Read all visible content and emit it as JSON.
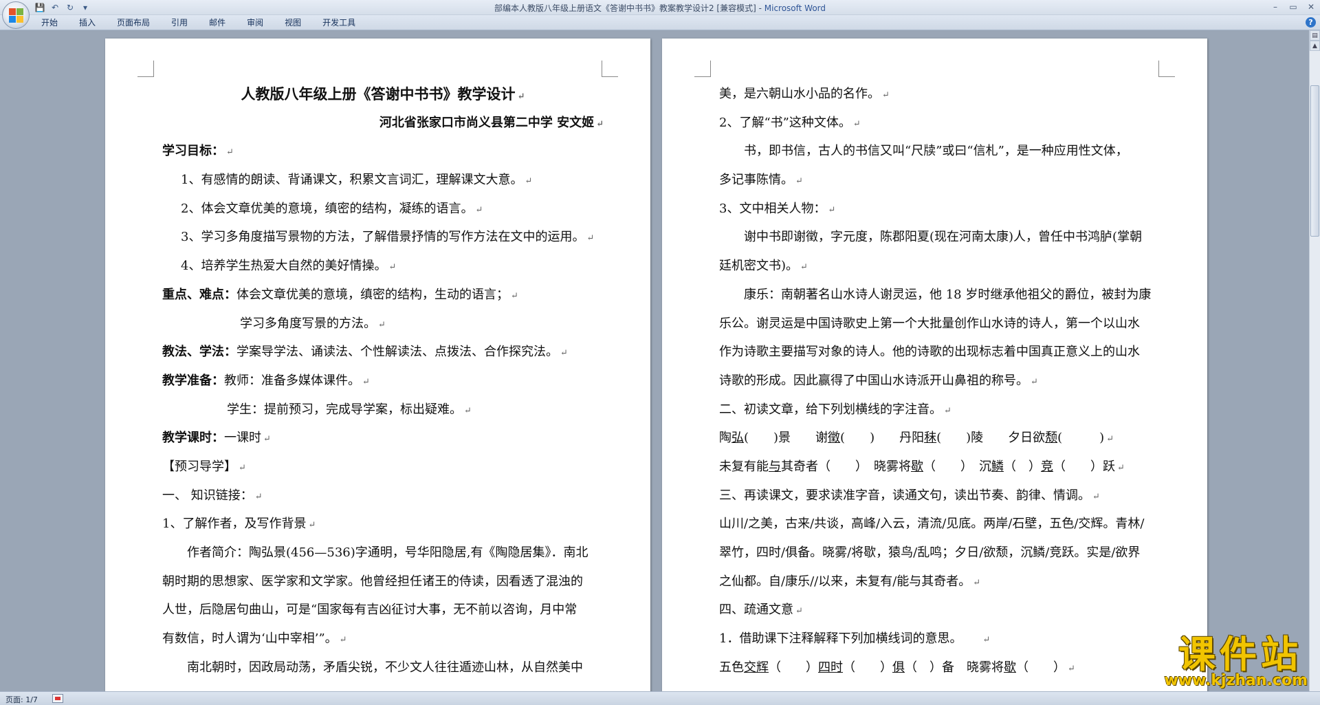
{
  "window": {
    "title": "部编本人教版八年级上册语文《答谢中书书》教案教学设计2 [兼容模式]",
    "app": "Microsoft Word",
    "separator": " - "
  },
  "quick_access": [
    {
      "name": "save-icon",
      "glyph": "💾"
    },
    {
      "name": "undo-icon",
      "glyph": "↶"
    },
    {
      "name": "redo-icon",
      "glyph": "↻"
    },
    {
      "name": "customize-icon",
      "glyph": "▾"
    }
  ],
  "ribbon": {
    "tabs": [
      "开始",
      "插入",
      "页面布局",
      "引用",
      "邮件",
      "审阅",
      "视图",
      "开发工具"
    ]
  },
  "status": {
    "page": "页面: 1/7"
  },
  "watermark": {
    "main": "课件站",
    "url": "www.kjzhan.com"
  },
  "doc": {
    "left": [
      {
        "cls": "title",
        "runs": [
          {
            "t": "人教版八年级上册《答谢中书书》教学设计"
          }
        ],
        "mark": "↵"
      },
      {
        "cls": "right",
        "runs": [
          {
            "t": "河北省张家口市尚义县第二中学   安文姬"
          }
        ],
        "mark": "↵"
      },
      {
        "cls": "",
        "runs": [
          {
            "t": "学习目标：",
            "b": true
          }
        ],
        "mark": "↵"
      },
      {
        "cls": "indent1",
        "runs": [
          {
            "t": "1、有感情的朗读、背诵课文，积累文言词汇，理解课文大意。"
          }
        ],
        "mark": "↵"
      },
      {
        "cls": "indent1",
        "runs": [
          {
            "t": "2、体会文章优美的意境，缜密的结构，凝练的语言。"
          }
        ],
        "mark": "↵"
      },
      {
        "cls": "indent1",
        "runs": [
          {
            "t": "3、学习多角度描写景物的方法，了解借景抒情的写作方法在文中的运用。"
          }
        ],
        "mark": "↵"
      },
      {
        "cls": "indent1",
        "runs": [
          {
            "t": "4、培养学生热爱大自然的美好情操。"
          }
        ],
        "mark": "↵"
      },
      {
        "cls": "",
        "runs": [
          {
            "t": "重点、难点：",
            "b": true
          },
          {
            "t": "体会文章优美的意境，缜密的结构，生动的语言；"
          }
        ],
        "mark": "↵"
      },
      {
        "cls": "indent3",
        "runs": [
          {
            "t": "学习多角度写景的方法。"
          }
        ],
        "mark": "↵"
      },
      {
        "cls": "",
        "runs": [
          {
            "t": "教法、学法：",
            "b": true
          },
          {
            "t": "学案导学法、诵读法、个性解读法、点拨法、合作探究法。"
          }
        ],
        "mark": "↵"
      },
      {
        "cls": "",
        "runs": [
          {
            "t": "教学准备：",
            "b": true
          },
          {
            "t": "教师：准备多媒体课件。"
          }
        ],
        "mark": "↵"
      },
      {
        "cls": "indent4",
        "runs": [
          {
            "t": "学生：提前预习，完成导学案，标出疑难。"
          }
        ],
        "mark": "↵"
      },
      {
        "cls": "",
        "runs": [
          {
            "t": "教学课时：",
            "b": true
          },
          {
            "t": "一课时"
          }
        ],
        "mark": "↵"
      },
      {
        "cls": "",
        "runs": [
          {
            "t": "【预习导学】"
          }
        ],
        "mark": "↵"
      },
      {
        "cls": "",
        "runs": [
          {
            "t": "一、    知识链接："
          }
        ],
        "mark": "↵"
      },
      {
        "cls": "",
        "runs": [
          {
            "t": "1、了解作者，及写作背景"
          }
        ],
        "mark": "↵"
      },
      {
        "cls": "indent2",
        "runs": [
          {
            "t": "作者简介：陶弘景(456—536)字通明，号华阳隐居,有《陶隐居集》．南北"
          }
        ],
        "mark": ""
      },
      {
        "cls": "",
        "runs": [
          {
            "t": "朝时期的思想家、医学家和文学家。他曾经担任诸王的侍读，因看透了混浊的"
          }
        ],
        "mark": ""
      },
      {
        "cls": "",
        "runs": [
          {
            "t": "人世，后隐居句曲山，可是“国家每有吉凶征讨大事，无不前以咨询，月中常"
          }
        ],
        "mark": ""
      },
      {
        "cls": "",
        "runs": [
          {
            "t": "有数信，时人谓为‘山中宰相’”。"
          }
        ],
        "mark": "↵"
      },
      {
        "cls": "indent2",
        "runs": [
          {
            "t": "南北朝时，因政局动荡，矛盾尖锐，不少文人往往遁迹山林，从自然美中"
          }
        ],
        "mark": ""
      }
    ],
    "right": [
      {
        "cls": "",
        "runs": [
          {
            "t": "美，是六朝山水小品的名作。"
          }
        ],
        "mark": "↵"
      },
      {
        "cls": "",
        "runs": [
          {
            "t": "2、了解“书”这种文体。"
          }
        ],
        "mark": "↵"
      },
      {
        "cls": "indent2",
        "runs": [
          {
            "t": "书，即书信，古人的书信又叫“尺牍”或曰“信札”，是一种应用性文体，"
          }
        ],
        "mark": ""
      },
      {
        "cls": "",
        "runs": [
          {
            "t": "多记事陈情。"
          }
        ],
        "mark": "↵"
      },
      {
        "cls": "",
        "runs": [
          {
            "t": "3、文中相关人物："
          }
        ],
        "mark": "↵"
      },
      {
        "cls": "indent2",
        "runs": [
          {
            "t": "谢中书即谢徵，字元度，陈郡阳夏(现在河南太康)人，曾任中书鸿胪(掌朝"
          }
        ],
        "mark": ""
      },
      {
        "cls": "",
        "runs": [
          {
            "t": "廷机密文书)。"
          }
        ],
        "mark": "↵"
      },
      {
        "cls": "indent2",
        "runs": [
          {
            "t": "康乐：南朝著名山水诗人谢灵运，他 18 岁时继承他祖父的爵位，被封为康"
          }
        ],
        "mark": ""
      },
      {
        "cls": "",
        "runs": [
          {
            "t": "乐公。谢灵运是中国诗歌史上第一个大批量创作山水诗的诗人，第一个以山水"
          }
        ],
        "mark": ""
      },
      {
        "cls": "",
        "runs": [
          {
            "t": "作为诗歌主要描写对象的诗人。他的诗歌的出现标志着中国真正意义上的山水"
          }
        ],
        "mark": ""
      },
      {
        "cls": "",
        "runs": [
          {
            "t": "诗歌的形成。因此赢得了中国山水诗派开山鼻祖的称号。"
          }
        ],
        "mark": "↵"
      },
      {
        "cls": "",
        "runs": [
          {
            "t": "二、初读文章，给下列划横线的字注音。"
          }
        ],
        "mark": "↵"
      },
      {
        "cls": "",
        "runs": [
          {
            "t": "陶"
          },
          {
            "t": "弘",
            "u": true
          },
          {
            "t": "(　　)景　　谢"
          },
          {
            "t": "徵",
            "u": true
          },
          {
            "t": "(　　)　　丹阳"
          },
          {
            "t": "秣",
            "u": true
          },
          {
            "t": "(　　)陵　　夕日欲"
          },
          {
            "t": "颓",
            "u": true
          },
          {
            "t": "(　　　)"
          }
        ],
        "mark": "↵"
      },
      {
        "cls": "",
        "runs": [
          {
            "t": "未复有能"
          },
          {
            "t": "与",
            "u": true
          },
          {
            "t": "其奇者（　　）　晓雾将"
          },
          {
            "t": "歇",
            "u": true
          },
          {
            "t": "（　　）　沉"
          },
          {
            "t": "鳞",
            "u": true
          },
          {
            "t": "（　）"
          },
          {
            "t": "竞",
            "u": true
          },
          {
            "t": "（　　）跃"
          }
        ],
        "mark": "↵"
      },
      {
        "cls": "",
        "runs": [
          {
            "t": "三、再读课文，要求读准字音，读通文句，读出节奏、韵律、情调。"
          }
        ],
        "mark": "↵"
      },
      {
        "cls": "",
        "runs": [
          {
            "t": "山川/之美，古来/共谈，高峰/入云，清流/见底。两岸/石壁，五色/交辉。青林/"
          }
        ],
        "mark": ""
      },
      {
        "cls": "",
        "runs": [
          {
            "t": "翠竹，四时/俱备。晓雾/将歇，猿鸟/乱鸣；夕日/欲颓，沉鳞/竞跃。实是/欲界"
          }
        ],
        "mark": ""
      },
      {
        "cls": "",
        "runs": [
          {
            "t": "之仙都。自/康乐//以来，未复有/能与其奇者。"
          }
        ],
        "mark": "↵"
      },
      {
        "cls": "",
        "runs": [
          {
            "t": "四、疏通文意"
          }
        ],
        "mark": "↵"
      },
      {
        "cls": "",
        "runs": [
          {
            "t": "1．借助课下注释解释下列加横线词的意思。　　"
          }
        ],
        "mark": "↵"
      },
      {
        "cls": "",
        "runs": [
          {
            "t": "五色"
          },
          {
            "t": "交辉",
            "u": true
          },
          {
            "t": "（　　）"
          },
          {
            "t": "四时",
            "u": true
          },
          {
            "t": "（　　）"
          },
          {
            "t": "俱",
            "u": true
          },
          {
            "t": "（　）备　晓雾将"
          },
          {
            "t": "歇",
            "u": true
          },
          {
            "t": "（　　）"
          }
        ],
        "mark": "↵"
      }
    ]
  }
}
